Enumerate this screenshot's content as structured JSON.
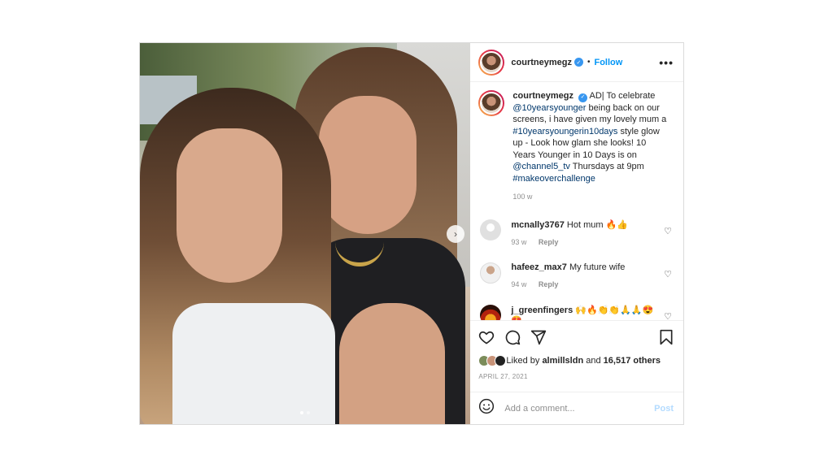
{
  "post": {
    "username": "courtneymegz",
    "follow_label": "Follow",
    "separator": "•",
    "more_label": "•••",
    "caption": {
      "username": "courtneymegz",
      "text_1": "AD| To celebrate",
      "mention_1": "@10yearsyounger",
      "text_2": "being back on our screens, i have given my lovely mum a",
      "hashtag_1": "#10yearsyoungerin10days",
      "text_3": "style glow up - Look how glam she looks! 10 Years Younger in 10 Days is on",
      "mention_2": "@channel5_tv",
      "text_4": "Thursdays at 9pm",
      "hashtag_2": "#makeoverchallenge",
      "age": "100 w"
    },
    "comments": [
      {
        "username": "mcnally3767",
        "text": "Hot mum 🔥👍",
        "age": "93 w",
        "reply": "Reply"
      },
      {
        "username": "hafeez_max7",
        "text": "My future wife",
        "age": "94 w",
        "reply": "Reply"
      },
      {
        "username": "j_greenfingers",
        "text": "🙌🔥👏👏🙏🙏😍😍"
      }
    ],
    "likes": {
      "prefix": "Liked by",
      "user": "almillsldn",
      "conj": "and",
      "count": "16,517 others"
    },
    "date": "APRIL 27, 2021",
    "add_comment_placeholder": "Add a comment...",
    "post_label": "Post",
    "next_icon": "chevron-right-icon",
    "colors": {
      "link": "#00376b",
      "follow": "#0095f6",
      "verified": "#3897f0"
    }
  }
}
